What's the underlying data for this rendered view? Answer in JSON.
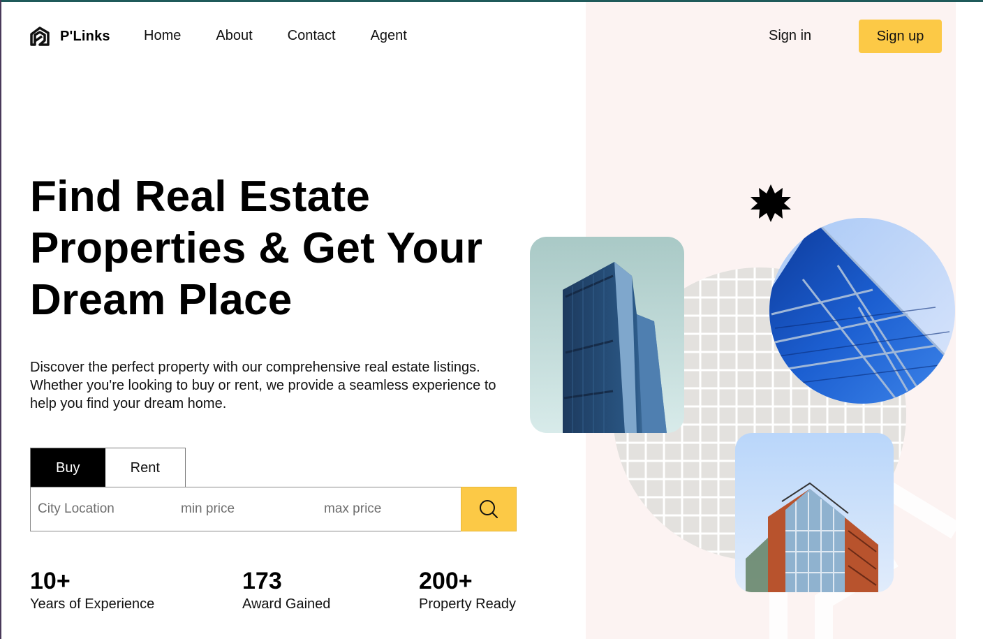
{
  "brand": {
    "name": "P'Links",
    "accent": "#fcc946"
  },
  "nav": {
    "items": [
      {
        "label": "Home"
      },
      {
        "label": "About"
      },
      {
        "label": "Contact"
      },
      {
        "label": "Agent"
      }
    ],
    "signin_label": "Sign in",
    "signup_label": "Sign up"
  },
  "hero": {
    "title_lines": [
      "Find Real Estate",
      "Properties & Get Your",
      "Dream Place"
    ],
    "description": "Discover the perfect property with our comprehensive real estate listings. Whether you're looking to buy or rent, we provide a seamless experience to help you find your dream home."
  },
  "search": {
    "tabs": [
      {
        "label": "Buy",
        "active": true
      },
      {
        "label": "Rent",
        "active": false
      }
    ],
    "city_placeholder": "City Location",
    "min_placeholder": "min price",
    "max_placeholder": "max price",
    "button_icon": "search-icon"
  },
  "stats": [
    {
      "value": "10+",
      "label": "Years of Experience"
    },
    {
      "value": "173",
      "label": "Award Gained"
    },
    {
      "value": "200+",
      "label": "Property Ready"
    }
  ]
}
